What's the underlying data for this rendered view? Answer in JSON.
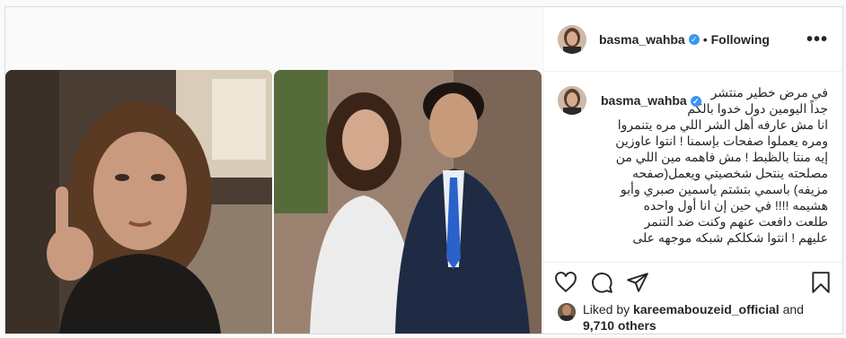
{
  "post": {
    "username": "basma_wahba",
    "follow_status": "Following",
    "separator": "•",
    "verified_glyph": "✓",
    "more_glyph": "•••"
  },
  "caption": {
    "lines": [
      "في مرض خطير منتشر",
      "جداً اليومين دول خدوا بالكم",
      "انا مش عارفه أهل الشر اللي مره يتنمروا",
      "ومره يعملوا صفحات بإسمنا ! انتوا عاوزين",
      "إيه منتا بالظبط ! مش فاهمه مين اللي من",
      "مصلحته ينتحل شخصيتي ويعمل(صفحه",
      "مزيفه) باسمي بتشتم ياسمين صبري وأبو",
      "هشيمه !!!! في حين إن انا أول واحده",
      "طلعت دافعت عنهم وكنت ضد التنمر",
      "عليهم ! انتوا شكلكم شبكه موجهه على"
    ]
  },
  "actions": {
    "like": "heart-icon",
    "comment": "comment-icon",
    "share": "share-icon",
    "save": "bookmark-icon"
  },
  "likes": {
    "prefix": "Liked by",
    "user": "kareemabouzeid_official",
    "and": "and",
    "count": "9,710 others"
  }
}
